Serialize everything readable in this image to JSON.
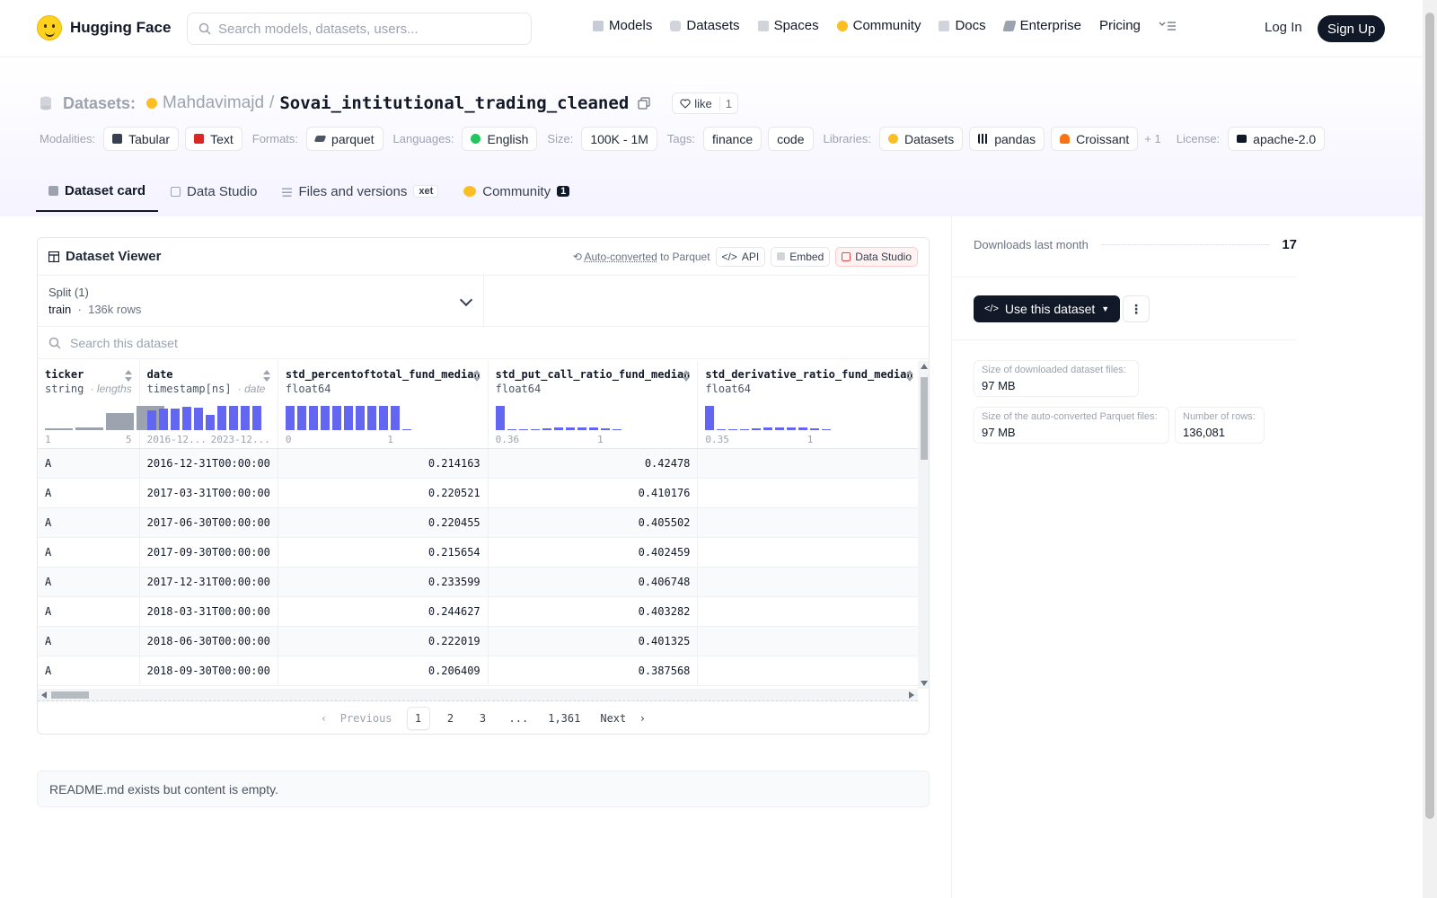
{
  "nav": {
    "brand": "Hugging Face",
    "search_placeholder": "Search models, datasets, users...",
    "items": [
      "Models",
      "Datasets",
      "Spaces",
      "Community",
      "Docs",
      "Enterprise",
      "Pricing"
    ],
    "login": "Log In",
    "signup": "Sign Up"
  },
  "header": {
    "section": "Datasets:",
    "owner": "Mahdavimajd",
    "sep": "/",
    "repo": "Sovai_intitutional_trading_cleaned",
    "like_label": "like",
    "like_count": "1",
    "tags": {
      "modalities_label": "Modalities:",
      "modalities": [
        "Tabular",
        "Text"
      ],
      "formats_label": "Formats:",
      "formats": [
        "parquet"
      ],
      "languages_label": "Languages:",
      "languages": [
        "English"
      ],
      "size_label": "Size:",
      "size": [
        "100K - 1M"
      ],
      "tags_label": "Tags:",
      "tags": [
        "finance",
        "code"
      ],
      "libraries_label": "Libraries:",
      "libraries": [
        "Datasets",
        "pandas",
        "Croissant"
      ],
      "libraries_more": "+ 1",
      "license_label": "License:",
      "license": [
        "apache-2.0"
      ]
    },
    "tabs": [
      {
        "label": "Dataset card",
        "active": true
      },
      {
        "label": "Data Studio"
      },
      {
        "label": "Files and versions",
        "badge": "xet"
      },
      {
        "label": "Community",
        "count": "1"
      }
    ]
  },
  "viewer": {
    "title": "Dataset Viewer",
    "auto_converted": "Auto-converted",
    "to_parquet": "to Parquet",
    "api": "API",
    "embed": "Embed",
    "data_studio": "Data Studio",
    "split_label": "Split (1)",
    "split_name": "train",
    "split_rows": "136k rows",
    "search_placeholder": "Search this dataset",
    "columns": [
      {
        "name": "ticker",
        "type": "string",
        "subtype": "· lengths",
        "min": "1",
        "max": "5"
      },
      {
        "name": "date",
        "type": "timestamp[ns]",
        "subtype": "· date",
        "min": "2016-12...",
        "max": "2023-12..."
      },
      {
        "name": "std_percentoftotal_fund_median",
        "type": "float64",
        "subtype": "",
        "min": "0",
        "max": "1"
      },
      {
        "name": "std_put_call_ratio_fund_median",
        "type": "float64",
        "subtype": "",
        "min": "0.36",
        "max": "1"
      },
      {
        "name": "std_derivative_ratio_fund_median",
        "type": "float64",
        "subtype": "",
        "min": "0.35",
        "max": "1"
      }
    ],
    "histograms": [
      [
        0.08,
        0.12,
        0.68,
        0.95
      ],
      [
        0.8,
        0.85,
        0.85,
        0.92,
        0.9,
        0.62,
        0.95,
        0.95,
        0.95,
        0.95
      ],
      [
        0.95,
        0.95,
        0.95,
        0.95,
        0.95,
        0.95,
        0.95,
        0.95,
        0.95,
        0.95,
        0.05
      ],
      [
        0.95,
        0.05,
        0.02,
        0.05,
        0.08,
        0.1,
        0.12,
        0.12,
        0.1,
        0.06,
        0.02
      ],
      [
        0.95,
        0.04,
        0.02,
        0.05,
        0.08,
        0.1,
        0.12,
        0.12,
        0.1,
        0.06,
        0.02
      ]
    ],
    "rows": [
      [
        "A",
        "2016-12-31T00:00:00",
        "0.214163",
        "0.42478",
        ""
      ],
      [
        "A",
        "2017-03-31T00:00:00",
        "0.220521",
        "0.410176",
        ""
      ],
      [
        "A",
        "2017-06-30T00:00:00",
        "0.220455",
        "0.405502",
        ""
      ],
      [
        "A",
        "2017-09-30T00:00:00",
        "0.215654",
        "0.402459",
        ""
      ],
      [
        "A",
        "2017-12-31T00:00:00",
        "0.233599",
        "0.406748",
        ""
      ],
      [
        "A",
        "2018-03-31T00:00:00",
        "0.244627",
        "0.403282",
        ""
      ],
      [
        "A",
        "2018-06-30T00:00:00",
        "0.222019",
        "0.401325",
        ""
      ],
      [
        "A",
        "2018-09-30T00:00:00",
        "0.206409",
        "0.387568",
        ""
      ]
    ],
    "pager": {
      "prev": "Previous",
      "pages": [
        "1",
        "2",
        "3",
        "...",
        "1,361"
      ],
      "next": "Next"
    }
  },
  "readme": "README.md exists but content is empty.",
  "sidebar": {
    "downloads_label": "Downloads last month",
    "downloads_value": "17",
    "use_btn": "Use this dataset",
    "more": "⋮",
    "stats": [
      {
        "k": "Size of downloaded dataset files:",
        "v": "97 MB"
      },
      {
        "k": "Size of the auto-converted Parquet files:",
        "v": "97 MB"
      },
      {
        "k": "Number of rows:",
        "v": "136,081"
      }
    ]
  },
  "colors": {
    "accent": "#6366f1",
    "dark": "#111827",
    "logo": "#ffd21e"
  }
}
